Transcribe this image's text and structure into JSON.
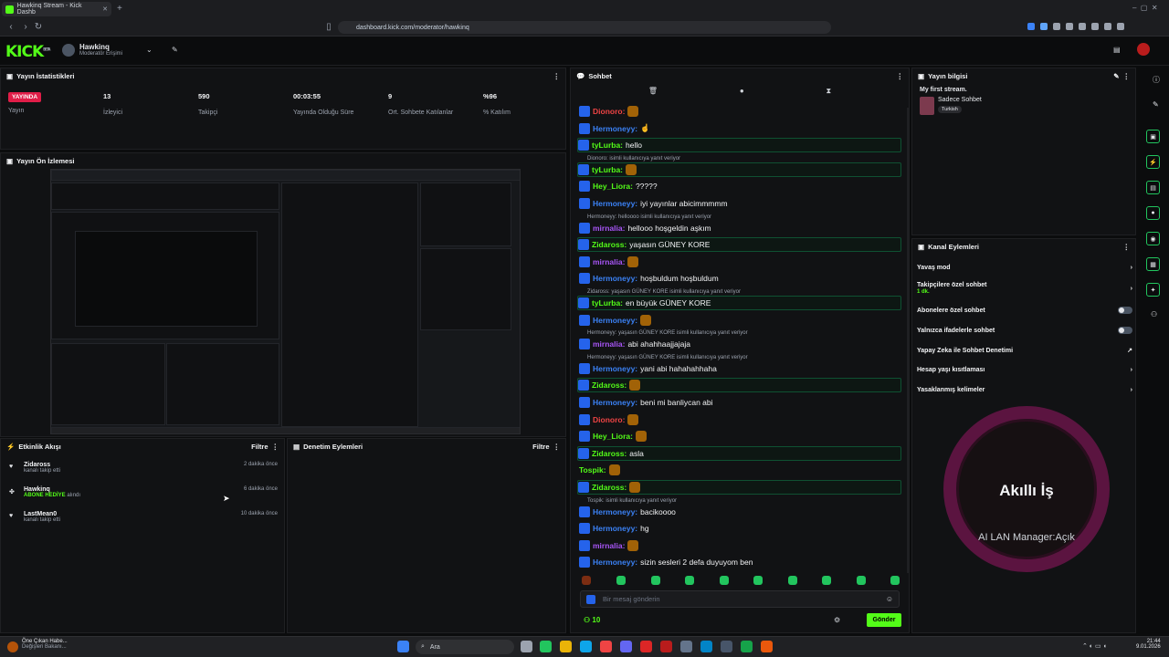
{
  "browser": {
    "tab_title": "Hawkinq Stream - Kick Dashb",
    "url": "dashboard.kick.com/moderator/hawkinq"
  },
  "topbar": {
    "logo": "KICK",
    "beta": "BETA",
    "username": "Hawkinq",
    "role": "Moderatör Erişimi"
  },
  "stats": {
    "title": "Yayın İstatistikleri",
    "items": [
      {
        "value": "YAYINDA",
        "label": "Yayın"
      },
      {
        "value": "13",
        "label": "İzleyici"
      },
      {
        "value": "590",
        "label": "Takipçi"
      },
      {
        "value": "00:03:55",
        "label": "Yayında Olduğu Süre"
      },
      {
        "value": "9",
        "label": "Ort. Sohbete Katılanlar"
      },
      {
        "value": "%96",
        "label": "% Katılım"
      }
    ]
  },
  "preview": {
    "title": "Yayın Ön İzlemesi"
  },
  "activity": {
    "title": "Etkinlik Akışı",
    "filter": "Filtre",
    "items": [
      {
        "name": "Zidaross",
        "desc": "kanalı takip etti",
        "time": "2 dakika önce"
      },
      {
        "name": "Hawkinq",
        "desc_highlight": "ABONE HEDİYE",
        "desc": "alındı",
        "time": "6 dakika önce"
      },
      {
        "name": "LastMean0",
        "desc": "kanalı takip etti",
        "time": "10 dakika önce"
      }
    ]
  },
  "moderation": {
    "title": "Denetim Eylemleri",
    "filter": "Filtre"
  },
  "chat": {
    "title": "Sohbet",
    "messages": [
      {
        "user": "Dionoro",
        "color": "#ef4444",
        "text": "",
        "hl": false
      },
      {
        "user": "Hermoneyy",
        "color": "#3b82f6",
        "text": "☝",
        "hl": false
      },
      {
        "user": "tyLurba",
        "color": "#53fc18",
        "text": "hello",
        "hl": true
      },
      {
        "user": "tyLurba",
        "color": "#53fc18",
        "text": "",
        "hl": true,
        "reply": "Dionoro:  isimli kullanıcıya yanıt veriyor"
      },
      {
        "user": "Hey_Liora",
        "color": "#53fc18",
        "text": "?????",
        "hl": false
      },
      {
        "user": "Hermoneyy",
        "color": "#3b82f6",
        "text": "iyi yayınlar abicimmmmm",
        "hl": false
      },
      {
        "user": "mirnalia",
        "color": "#a855f7",
        "text": "hellooo hoşgeldin aşkım",
        "hl": false,
        "reply": "Hermoneyy: helloooo isimli kullanıcıya yanıt veriyor"
      },
      {
        "user": "Zidaross",
        "color": "#53fc18",
        "text": "yaşasın GÜNEY KORE",
        "hl": true
      },
      {
        "user": "mirnalia",
        "color": "#a855f7",
        "text": "",
        "hl": false
      },
      {
        "user": "Hermoneyy",
        "color": "#3b82f6",
        "text": "hoşbuldum hoşbuldum",
        "hl": false
      },
      {
        "user": "tyLurba",
        "color": "#53fc18",
        "text": "en büyük GÜNEY KORE",
        "hl": true,
        "reply": "Zidaross: yaşasın GÜNEY KORE isimli kullanıcıya yanıt veriyor"
      },
      {
        "user": "Hermoneyy",
        "color": "#3b82f6",
        "text": "",
        "hl": false
      },
      {
        "user": "mirnalia",
        "color": "#a855f7",
        "text": "abi ahahhaajjajaja",
        "hl": false,
        "reply": "Hermoneyy: yaşasın GÜNEY KORE isimli kullanıcıya yanıt veriyor"
      },
      {
        "user": "Hermoneyy",
        "color": "#3b82f6",
        "text": "yani abi hahahahhaha",
        "hl": false,
        "reply": "Hermoneyy: yaşasın GÜNEY KORE isimli kullanıcıya yanıt veriyor"
      },
      {
        "user": "Zidaross",
        "color": "#53fc18",
        "text": "",
        "hl": true
      },
      {
        "user": "Hermoneyy",
        "color": "#3b82f6",
        "text": "beni mi banliycan abi",
        "hl": false
      },
      {
        "user": "Dionoro",
        "color": "#ef4444",
        "text": "",
        "hl": false
      },
      {
        "user": "Hey_Liora",
        "color": "#53fc18",
        "text": "",
        "hl": false
      },
      {
        "user": "Zidaross",
        "color": "#53fc18",
        "text": "asla",
        "hl": true
      },
      {
        "user": "Tospik",
        "color": "#53fc18",
        "text": "",
        "hl": false
      },
      {
        "user": "Zidaross",
        "color": "#53fc18",
        "text": "",
        "hl": true
      },
      {
        "user": "Hermoneyy",
        "color": "#3b82f6",
        "text": "bacikoooo",
        "hl": false,
        "reply": "Tospik:  isimli kullanıcıya yanıt veriyor"
      },
      {
        "user": "Hermoneyy",
        "color": "#3b82f6",
        "text": "hg",
        "hl": false
      },
      {
        "user": "mirnalia",
        "color": "#a855f7",
        "text": "",
        "hl": false
      },
      {
        "user": "Hermoneyy",
        "color": "#3b82f6",
        "text": "sizin sesleri 2 defa duyuyom ben",
        "hl": false
      }
    ],
    "input_placeholder": "Bir mesaj gönderin",
    "viewer_count": "10",
    "send_label": "Gönder"
  },
  "stream_info": {
    "title": "Yayın bilgisi",
    "stream_title": "My first stream.",
    "category": "Sadece Sohbet",
    "tag": "Turkish"
  },
  "channel_actions": {
    "title": "Kanal Eylemleri",
    "items": [
      {
        "label": "Yavaş mod",
        "kind": "arrow"
      },
      {
        "label": "Takipçilere özel sohbet",
        "sub": "1 dk.",
        "kind": "arrow"
      },
      {
        "label": "Abonelere özel sohbet",
        "kind": "toggle"
      },
      {
        "label": "Yalnızca ifadelerle sohbet",
        "kind": "toggle"
      },
      {
        "label": "Yapay Zeka ile Sohbet Denetimi",
        "kind": "external"
      },
      {
        "label": "Hesap yaşı kısıtlaması",
        "kind": "arrow"
      },
      {
        "label": "Yasaklanmış kelimeler",
        "kind": "arrow"
      }
    ]
  },
  "overlay": {
    "title": "Akıllı İş",
    "subtitle": "AI LAN Manager:Açık"
  },
  "taskbar": {
    "news_title": "Öne Çıkan Habe...",
    "news_sub": "Değişleri Bakanı...",
    "search": "Ara",
    "time": "21:44",
    "date": "9.01.2026"
  },
  "colors": {
    "accent": "#53fc18",
    "live": "#e11d48"
  }
}
